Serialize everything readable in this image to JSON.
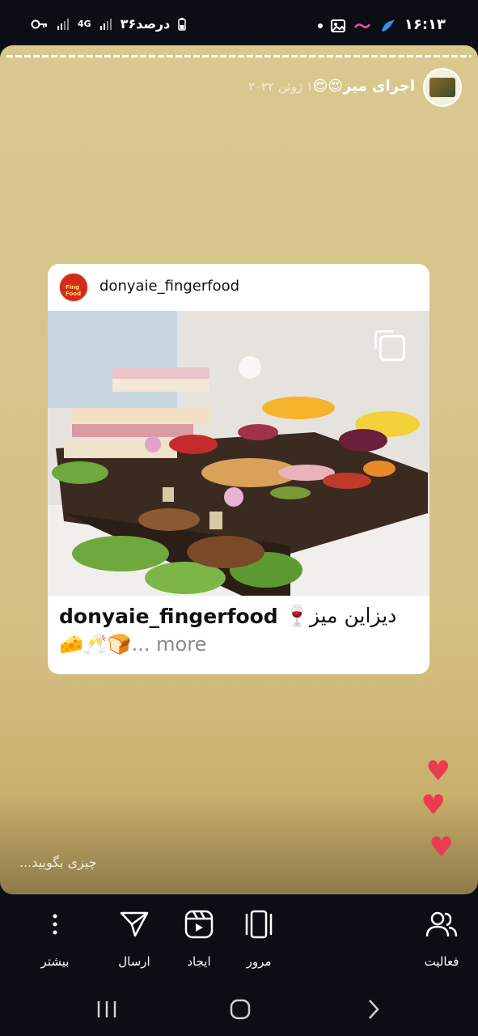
{
  "status_bar": {
    "time": "۱۶:۱۳",
    "battery_text": "۳۶درصد",
    "network": "4G"
  },
  "story": {
    "title": "اجرای میز😍😍",
    "date": "۱۲ ژوئن ۲۰۲۲",
    "reply_placeholder": "چیزی بگویید...",
    "hearts": [
      "♥",
      "♥",
      "♥"
    ]
  },
  "post_card": {
    "username": "donyaie_fingerfood",
    "logo_text": "Fing Food",
    "image_icon": "multiple-photos-icon",
    "caption_user": "donyaie_fingerfood",
    "caption_text": "دیزاین میز🍷",
    "caption_emojis": "🧀🥂🍞",
    "caption_more": "... more"
  },
  "actions": {
    "activity": "فعالیت",
    "browse": "مرور",
    "create": "ایجاد",
    "send": "ارسال",
    "more": "بیشتر"
  },
  "colors": {
    "story_bg": "#d8c78d",
    "heart": "#ec3b4f",
    "bar_bg": "#0b0e14"
  }
}
